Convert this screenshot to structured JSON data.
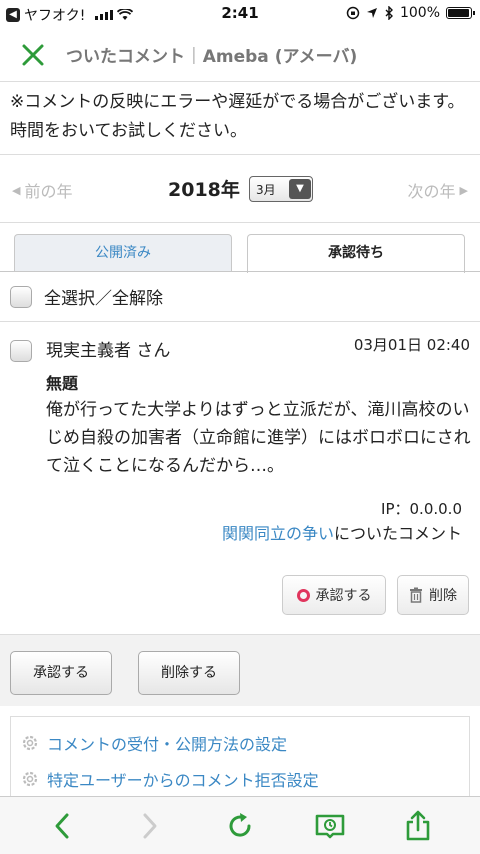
{
  "status_bar": {
    "back_app": "ヤフオク!",
    "time": "2:41",
    "battery": "100%",
    "battery_level": 1.0
  },
  "header": {
    "title": "ついたコメント",
    "separator": "|",
    "site": "Ameba (アメーバ)"
  },
  "notice": "※コメントの反映にエラーや遅延がでる場合がございます。時間をおいてお試しください。",
  "year_nav": {
    "prev": "前の年",
    "year": "2018年",
    "month": "3月",
    "next": "次の年"
  },
  "tabs": [
    {
      "label": "公開済み",
      "active": false
    },
    {
      "label": "承認待ち",
      "active": true
    }
  ],
  "select_all": "全選択／全解除",
  "comment": {
    "author": "現実主義者 さん",
    "date": "03月01日 02:40",
    "subject": "無題",
    "body": "俺が行ってた大学よりはずっと立派だが、滝川高校のいじめ自殺の加害者（立命館に進学）にはボロボロにされて泣くことになるんだから…。",
    "ip": "IP：0.0.0.0",
    "post_link": "関関同立の争い",
    "post_suffix": "についたコメント",
    "approve": "承認する",
    "delete": "削除"
  },
  "bulk": {
    "approve": "承認する",
    "delete": "削除する"
  },
  "settings": [
    "コメントの受付・公開方法の設定",
    "特定ユーザーからのコメント拒否設定"
  ],
  "colors": {
    "accent_green": "#2e9b3a",
    "link_blue": "#3b88c4",
    "approve_ring": "#e0355d"
  },
  "toolbar_icons": [
    "back-icon",
    "forward-icon",
    "reload-icon",
    "reading-list-icon",
    "share-icon"
  ]
}
